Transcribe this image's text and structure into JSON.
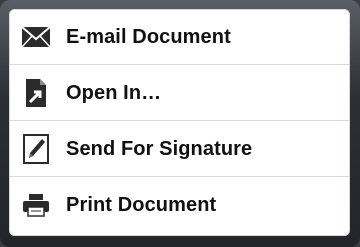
{
  "menu": {
    "items": [
      {
        "label": "E-mail Document",
        "icon": "envelope-icon"
      },
      {
        "label": "Open In…",
        "icon": "open-in-icon"
      },
      {
        "label": "Send For Signature",
        "icon": "pen-signature-icon"
      },
      {
        "label": "Print Document",
        "icon": "printer-icon"
      }
    ]
  },
  "colors": {
    "icon": "#2b2b2b",
    "text": "#111111",
    "separator": "#d9d9d9"
  }
}
